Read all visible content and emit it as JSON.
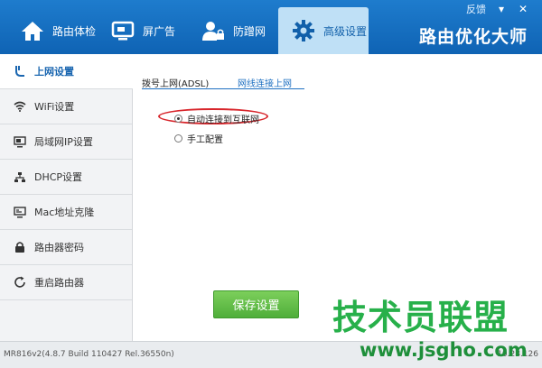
{
  "window": {
    "feedback_label": "反馈",
    "minimize_glyph": "▾",
    "close_glyph": "✕"
  },
  "nav": {
    "brand": "路由优化大师",
    "tabs": [
      {
        "label": "路由体检",
        "icon": "home-icon"
      },
      {
        "label": "屏广告",
        "icon": "screen-icon"
      },
      {
        "label": "防蹭网",
        "icon": "user-lock-icon"
      },
      {
        "label": "高级设置",
        "icon": "gear-icon",
        "active": true
      }
    ]
  },
  "sidebar": {
    "items": [
      {
        "label": "上网设置",
        "icon": "internet-plug-icon",
        "active": true
      },
      {
        "label": "WiFi设置",
        "icon": "wifi-icon"
      },
      {
        "label": "局域网IP设置",
        "icon": "lan-icon"
      },
      {
        "label": "DHCP设置",
        "icon": "dhcp-network-icon"
      },
      {
        "label": "Mac地址克隆",
        "icon": "monitor-icon"
      },
      {
        "label": "路由器密码",
        "icon": "lock-icon"
      },
      {
        "label": "重启路由器",
        "icon": "restart-icon"
      }
    ]
  },
  "content": {
    "subtabs": [
      {
        "label": "拨号上网(ADSL)"
      },
      {
        "label": "网线连接上网",
        "active": true
      }
    ],
    "options": [
      {
        "label": "自动连接到互联网",
        "checked": true
      },
      {
        "label": "手工配置",
        "checked": false
      }
    ],
    "save_label": "保存设置"
  },
  "status": {
    "left": "MR816v2(4.8.7 Build 110427 Rel.36550n)",
    "right": "10.28.126"
  },
  "watermark": {
    "main": "技术员联盟",
    "url": "www.jsgho.com"
  },
  "colors": {
    "topbar": "#1470c0",
    "active_tab": "#bfe0f6",
    "accent": "#1d6fc1",
    "save_button": "#5cb845",
    "highlight": "#d8262c",
    "watermark": "#27b04a"
  }
}
